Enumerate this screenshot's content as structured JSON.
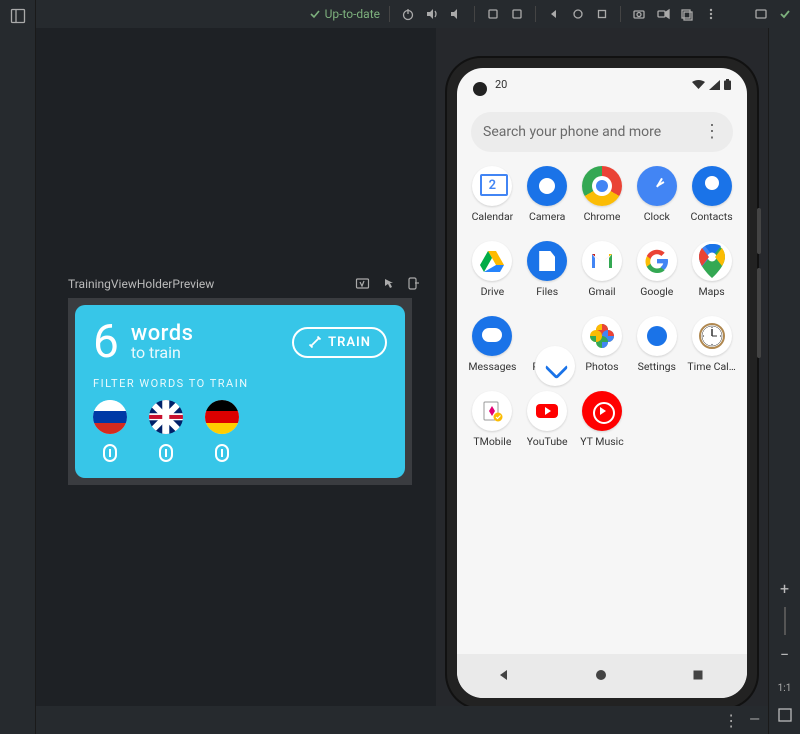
{
  "topbar": {
    "sync_label": "Up-to-date"
  },
  "preview": {
    "title": "TrainingViewHolderPreview",
    "card": {
      "number": "6",
      "words": "words",
      "to_train": "to train",
      "train_btn": "TRAIN",
      "filter_label": "FILTER WORDS TO TRAIN"
    }
  },
  "phone": {
    "time": "20",
    "search_placeholder": "Search your phone and more",
    "apps": [
      {
        "key": "calendar",
        "label": "Calendar"
      },
      {
        "key": "camera",
        "label": "Camera"
      },
      {
        "key": "chrome",
        "label": "Chrome"
      },
      {
        "key": "clock",
        "label": "Clock"
      },
      {
        "key": "contacts",
        "label": "Contacts"
      },
      {
        "key": "drive",
        "label": "Drive"
      },
      {
        "key": "files",
        "label": "Files"
      },
      {
        "key": "gmail",
        "label": "Gmail"
      },
      {
        "key": "google",
        "label": "Google"
      },
      {
        "key": "maps",
        "label": "Maps"
      },
      {
        "key": "messages",
        "label": "Messages"
      },
      {
        "key": "phone",
        "label": "Phone"
      },
      {
        "key": "photos",
        "label": "Photos"
      },
      {
        "key": "settings",
        "label": "Settings"
      },
      {
        "key": "timecal",
        "label": "Time Cal…"
      },
      {
        "key": "tmobile",
        "label": "TMobile"
      },
      {
        "key": "youtube",
        "label": "YouTube"
      },
      {
        "key": "ytmusic",
        "label": "YT Music"
      }
    ]
  },
  "zoom": {
    "one_to_one": "1:1"
  },
  "colors": {
    "card_bg": "#37c6e8"
  }
}
